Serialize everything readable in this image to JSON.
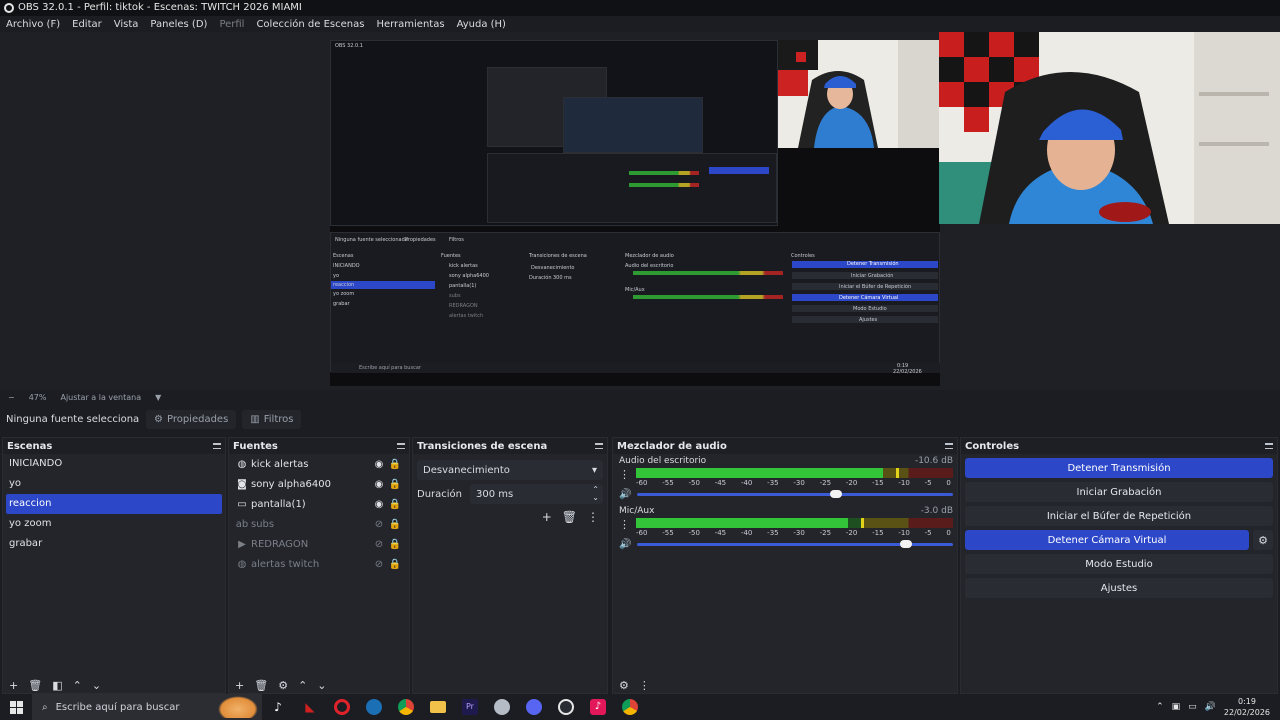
{
  "window": {
    "title": "OBS 32.0.1 - Perfil: tiktok - Escenas: TWITCH 2026 MIAMI"
  },
  "menu": [
    "Archivo (F)",
    "Editar",
    "Vista",
    "Paneles (D)",
    "Perfil",
    "Colección de Escenas",
    "Herramientas",
    "Ayuda (H)"
  ],
  "preview": {
    "zoom_minus": "−",
    "zoom": "47%",
    "fit": "Ajustar a la ventana",
    "nested": {
      "scenes_header": "Escenas",
      "sources_header": "Fuentes",
      "transitions_header": "Transiciones de escena",
      "mixer_header": "Mezclador de audio",
      "controls_header": "Controles",
      "no_source": "Ninguna fuente seleccionada",
      "properties": "Propiedades",
      "filters": "Filtros",
      "scenes": [
        "INICIANDO",
        "yo",
        "reaccion",
        "yo zoom",
        "grabar"
      ],
      "sources": [
        "kick alertas",
        "sony alpha6400",
        "pantalla(1)",
        "subs",
        "REDRAGON",
        "alertas twitch"
      ],
      "transition": "Desvanecimiento",
      "duration_label": "Duración",
      "duration": "300 ms",
      "desktop_audio": "Audio del escritorio",
      "mic": "Mic/Aux",
      "controls": [
        "Detener Transmisión",
        "Iniciar Grabación",
        "Iniciar el Búfer de Repetición",
        "Detener Cámara Virtual",
        "Modo Estudio",
        "Ajustes"
      ],
      "search": "Escribe aquí para buscar",
      "time": "0:19",
      "date": "22/02/2026"
    }
  },
  "props_strip": {
    "no_source": "Ninguna fuente selecciona",
    "properties": "Propiedades",
    "filters": "Filtros"
  },
  "scenes": {
    "header": "Escenas",
    "items": [
      "INICIANDO",
      "yo",
      "reaccion",
      "yo zoom",
      "grabar"
    ],
    "selected": "reaccion"
  },
  "sources": {
    "header": "Fuentes",
    "items": [
      {
        "name": "kick alertas",
        "icon": "globe-icon",
        "visible": true
      },
      {
        "name": "sony alpha6400",
        "icon": "camera-icon",
        "visible": true
      },
      {
        "name": "pantalla(1)",
        "icon": "monitor-icon",
        "visible": true
      },
      {
        "name": "subs",
        "icon": "text-icon",
        "visible": false
      },
      {
        "name": "REDRAGON",
        "icon": "play-icon",
        "visible": false
      },
      {
        "name": "alertas twitch",
        "icon": "globe-icon",
        "visible": false
      }
    ]
  },
  "transitions": {
    "header": "Transiciones de escena",
    "selected": "Desvanecimiento",
    "duration_label": "Duración",
    "duration": "300 ms"
  },
  "mixer": {
    "header": "Mezclador de audio",
    "tracks": [
      {
        "name": "Audio del escritorio",
        "db": "-10.6 dB",
        "level": 0.78,
        "peak": 0.82,
        "volume": 0.63
      },
      {
        "name": "Mic/Aux",
        "db": "-3.0 dB",
        "level": 0.67,
        "peak": 0.71,
        "volume": 0.85
      }
    ],
    "ticks": [
      "-60",
      "-55",
      "-50",
      "-45",
      "-40",
      "-35",
      "-30",
      "-25",
      "-20",
      "-15",
      "-10",
      "-5",
      "0"
    ]
  },
  "controls": {
    "header": "Controles",
    "stop_stream": "Detener Transmisión",
    "start_recording": "Iniciar Grabación",
    "start_replay": "Iniciar el Búfer de Repetición",
    "stop_vcam": "Detener Cámara Virtual",
    "studio_mode": "Modo Estudio",
    "settings": "Ajustes"
  },
  "taskbar": {
    "search_placeholder": "Escribe aquí para buscar",
    "time": "0:19",
    "date": "22/02/2026",
    "apps": [
      "tiktok-icon",
      "redragon-icon",
      "opera-icon",
      "steam-icon",
      "chrome-icon",
      "folder-icon",
      "premiere-icon",
      "app-icon",
      "discord-icon",
      "obs-icon",
      "tiktok-studio-icon",
      "chrome-profile-icon"
    ]
  },
  "colors": {
    "accent": "#2c47c8",
    "meter_green": "#33c43a",
    "meter_yellow": "#e4d31a",
    "meter_red": "#c42a2a"
  }
}
